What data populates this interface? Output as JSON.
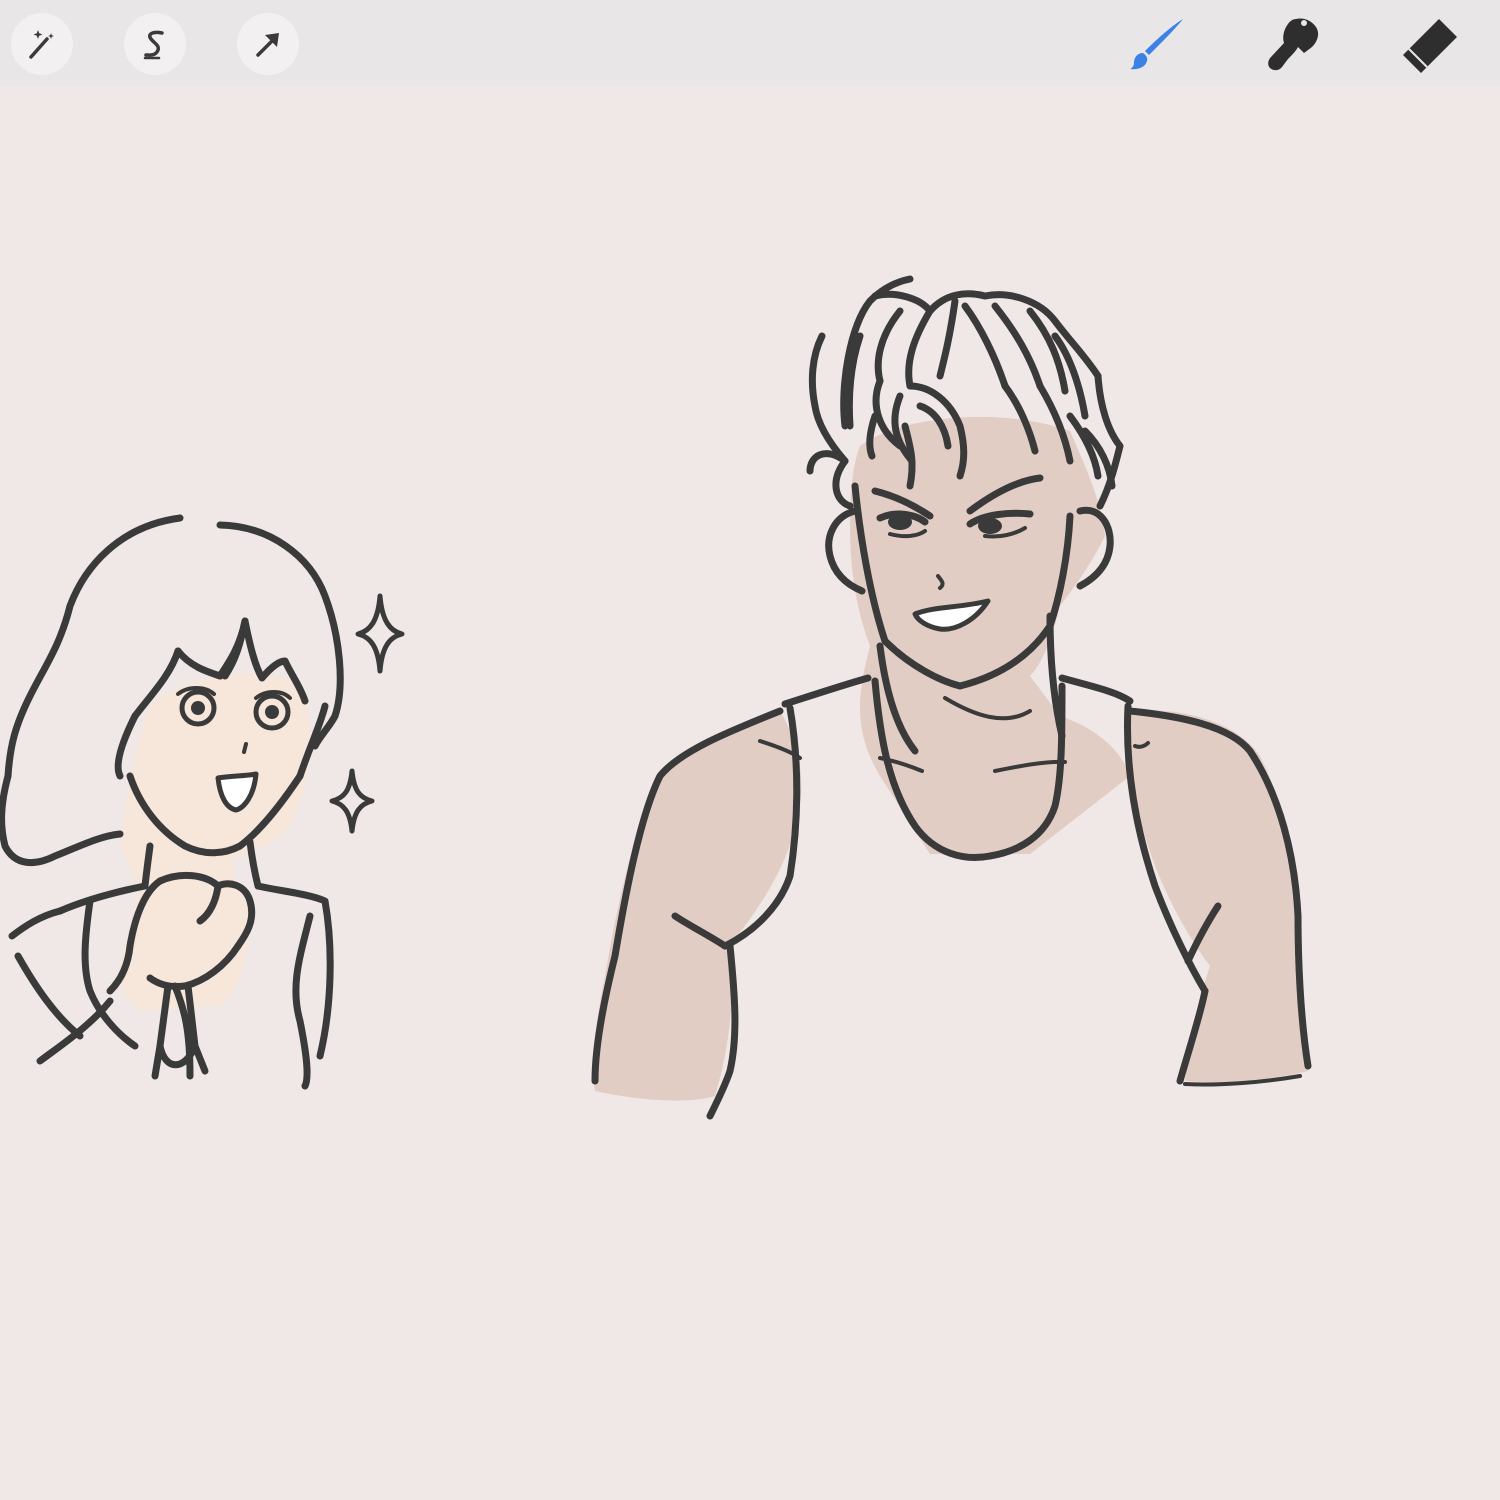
{
  "toolbar": {
    "left_tools": [
      {
        "icon": "magic-wand-icon",
        "name": "adjustments"
      },
      {
        "icon": "selection-s-icon",
        "name": "selection"
      },
      {
        "icon": "arrow-cursor-icon",
        "name": "transform"
      }
    ],
    "right_tools": [
      {
        "icon": "brush-icon",
        "name": "paint",
        "active": true
      },
      {
        "icon": "smudge-finger-icon",
        "name": "smudge",
        "active": false
      },
      {
        "icon": "eraser-icon",
        "name": "erase",
        "active": false
      }
    ]
  },
  "colors": {
    "canvas_background": "#f0e8e6",
    "toolbar_background": "#e8e6e6",
    "active_tool": "#3b82e6",
    "inactive_tool": "#2e2e2e",
    "ink": "#3a3a3a",
    "skin_girl": "#f7e6da",
    "skin_man": "#e2cdc4"
  }
}
